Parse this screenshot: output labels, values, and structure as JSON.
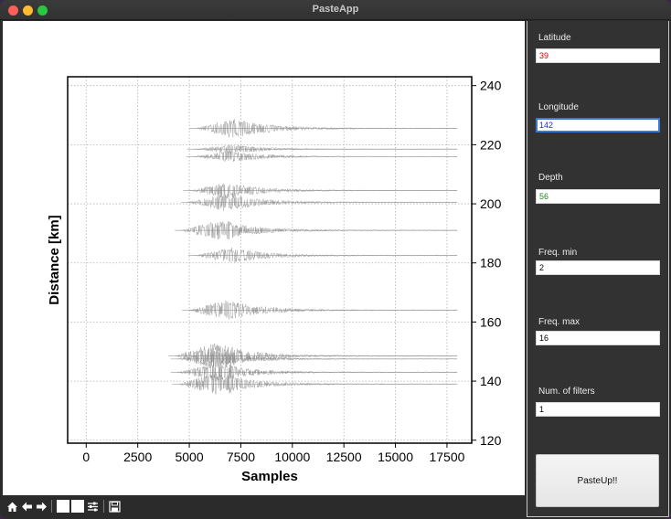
{
  "window": {
    "title": "PasteApp"
  },
  "chart_data": {
    "type": "line",
    "title": "",
    "xlabel": "Samples",
    "ylabel": "Distance [km]",
    "xlim": [
      -900,
      18700
    ],
    "ylim": [
      119,
      243
    ],
    "x_ticks": [
      0,
      2500,
      5000,
      7500,
      10000,
      12500,
      15000,
      17500
    ],
    "x_tick_labels": [
      "0",
      "2500",
      "5000",
      "7500",
      "10000",
      "12500",
      "15000",
      "17500"
    ],
    "y_ticks": [
      120,
      140,
      160,
      180,
      200,
      220,
      240
    ],
    "y_tick_labels": [
      "120",
      "140",
      "160",
      "180",
      "200",
      "220",
      "240"
    ],
    "y_axis_side": "right",
    "grid": true,
    "series_color": "#8c8c8c",
    "traces": [
      {
        "distance": 225.5,
        "onset": 5300,
        "end": 18000,
        "amp": 1.0
      },
      {
        "distance": 218.5,
        "onset": 5200,
        "end": 18000,
        "amp": 0.45
      },
      {
        "distance": 216.0,
        "onset": 5150,
        "end": 18000,
        "amp": 0.55
      },
      {
        "distance": 204.5,
        "onset": 5000,
        "end": 18000,
        "amp": 0.8
      },
      {
        "distance": 200.5,
        "onset": 4900,
        "end": 18000,
        "amp": 0.9
      },
      {
        "distance": 191.0,
        "onset": 4600,
        "end": 18000,
        "amp": 1.0
      },
      {
        "distance": 182.5,
        "onset": 5250,
        "end": 18000,
        "amp": 0.8
      },
      {
        "distance": 164.0,
        "onset": 4950,
        "end": 18000,
        "amp": 1.0
      },
      {
        "distance": 148.5,
        "onset": 4300,
        "end": 18000,
        "amp": 1.3
      },
      {
        "distance": 147.5,
        "onset": 4400,
        "end": 18000,
        "amp": 0.8
      },
      {
        "distance": 143.0,
        "onset": 4400,
        "end": 18000,
        "amp": 0.9
      },
      {
        "distance": 139.0,
        "onset": 4450,
        "end": 18000,
        "amp": 1.1
      }
    ]
  },
  "toolbar": {
    "home_icon": "home-icon",
    "back_icon": "arrow-left-icon",
    "forward_icon": "arrow-right-icon",
    "pan_icon": "pan-icon",
    "zoom_icon": "zoom-icon",
    "configure_icon": "sliders-icon",
    "save_icon": "floppy-save-icon"
  },
  "panel": {
    "fields": [
      {
        "label": "Latitude",
        "value": "39",
        "color": "#d60000"
      },
      {
        "label": "Longitude",
        "value": "142",
        "color": "#1a2fd6"
      },
      {
        "label": "Depth",
        "value": "56",
        "color": "#1a8a1a"
      },
      {
        "label": "Freq. min",
        "value": "2",
        "color": "#000000"
      },
      {
        "label": "Freq. max",
        "value": "16",
        "color": "#000000"
      },
      {
        "label": "Num. of filters",
        "value": "1",
        "color": "#000000"
      }
    ],
    "button_label": "PasteUp!!"
  }
}
